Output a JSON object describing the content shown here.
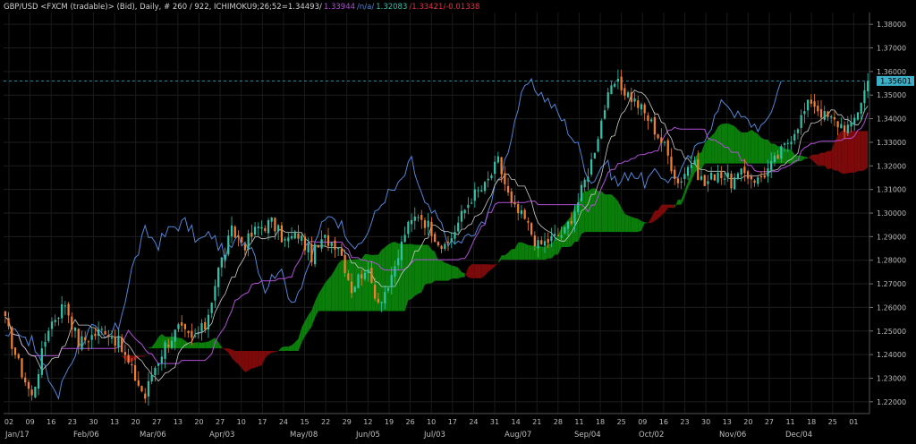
{
  "header": {
    "symbol": "GBP/USD <FXCM (tradable)> (Bid), Daily, # 260 / 922, ICHIMOKU9;26;52=1.34493/",
    "kijun_value": "1.33944",
    "chikou_value": "/n/a/",
    "senkou_a_value": "1.32083",
    "senkou_b_value": "/1.33421/-0.01338",
    "colors": {
      "symbol": "#cfcfcf",
      "kijun": "#b04fd8",
      "chikou": "#4f86d8",
      "senkou_a": "#32c0a8",
      "senkou_b": "#e0304a"
    }
  },
  "last_price_label": "1.35601",
  "chart_data": {
    "type": "candlestick",
    "title": "GBP/USD <FXCM (tradable)> (Bid), Daily",
    "indicator": "ICHIMOKU 9;26;52",
    "ylim": [
      1.215,
      1.385
    ],
    "y_ticks": [
      "1.22000",
      "1.23000",
      "1.24000",
      "1.25000",
      "1.26000",
      "1.27000",
      "1.28000",
      "1.29000",
      "1.30000",
      "1.31000",
      "1.32000",
      "1.33000",
      "1.34000",
      "1.35000",
      "1.36000",
      "1.37000",
      "1.38000"
    ],
    "x_labels": [
      "02",
      "09",
      "16",
      "23",
      "30",
      "Feb/06",
      "13",
      "20",
      "27",
      "Mar/06",
      "13",
      "20",
      "27",
      "Apr/03",
      "10",
      "17",
      "24",
      "May/08",
      "15",
      "22",
      "29",
      "Jun/05",
      "12",
      "19",
      "26",
      "Jul/03",
      "10",
      "17",
      "24",
      "31",
      "Aug/07",
      "14",
      "21",
      "28",
      "Sep/04",
      "11",
      "18",
      "25",
      "Oct/02",
      "09",
      "16",
      "23",
      "30",
      "Nov/06",
      "13",
      "20",
      "27",
      "Dec/04",
      "11",
      "18",
      "25",
      "01",
      "Jan/17"
    ],
    "month_labels": [
      "Jan/17",
      "Feb/06",
      "Mar/06",
      "Apr/03",
      "May/08",
      "Jun/05",
      "Jul/03",
      "Aug/07",
      "Sep/04",
      "Oct/02",
      "Nov/06",
      "Dec/04"
    ],
    "close_anchors": [
      [
        0,
        1.254
      ],
      [
        4,
        1.236
      ],
      [
        8,
        1.222
      ],
      [
        13,
        1.252
      ],
      [
        18,
        1.262
      ],
      [
        22,
        1.245
      ],
      [
        26,
        1.248
      ],
      [
        30,
        1.251
      ],
      [
        34,
        1.245
      ],
      [
        38,
        1.233
      ],
      [
        42,
        1.222
      ],
      [
        44,
        1.232
      ],
      [
        48,
        1.244
      ],
      [
        52,
        1.251
      ],
      [
        56,
        1.246
      ],
      [
        60,
        1.252
      ],
      [
        64,
        1.276
      ],
      [
        68,
        1.292
      ],
      [
        72,
        1.287
      ],
      [
        76,
        1.294
      ],
      [
        80,
        1.296
      ],
      [
        84,
        1.288
      ],
      [
        88,
        1.291
      ],
      [
        92,
        1.282
      ],
      [
        96,
        1.289
      ],
      [
        100,
        1.287
      ],
      [
        104,
        1.268
      ],
      [
        108,
        1.277
      ],
      [
        112,
        1.263
      ],
      [
        116,
        1.271
      ],
      [
        120,
        1.292
      ],
      [
        124,
        1.3
      ],
      [
        128,
        1.293
      ],
      [
        132,
        1.284
      ],
      [
        136,
        1.296
      ],
      [
        140,
        1.307
      ],
      [
        144,
        1.311
      ],
      [
        148,
        1.322
      ],
      [
        152,
        1.303
      ],
      [
        156,
        1.297
      ],
      [
        160,
        1.286
      ],
      [
        164,
        1.289
      ],
      [
        168,
        1.292
      ],
      [
        172,
        1.305
      ],
      [
        176,
        1.322
      ],
      [
        180,
        1.345
      ],
      [
        183,
        1.355
      ],
      [
        186,
        1.352
      ],
      [
        190,
        1.346
      ],
      [
        194,
        1.338
      ],
      [
        198,
        1.328
      ],
      [
        202,
        1.313
      ],
      [
        206,
        1.322
      ],
      [
        210,
        1.312
      ],
      [
        214,
        1.318
      ],
      [
        218,
        1.313
      ],
      [
        222,
        1.317
      ],
      [
        226,
        1.314
      ],
      [
        230,
        1.32
      ],
      [
        234,
        1.328
      ],
      [
        238,
        1.338
      ],
      [
        242,
        1.348
      ],
      [
        246,
        1.341
      ],
      [
        250,
        1.338
      ],
      [
        254,
        1.336
      ],
      [
        259,
        1.356
      ]
    ],
    "tenkan_color": "#cccccc",
    "kijun_color": "#b04fd8",
    "chikou_color": "#4f86d8",
    "up_color": "#32c0a8",
    "down_color": "#f08030",
    "kumo_bull_color": "#0a7d0a",
    "kumo_bear_color": "#7d0a0a",
    "last_price": 1.35601
  }
}
